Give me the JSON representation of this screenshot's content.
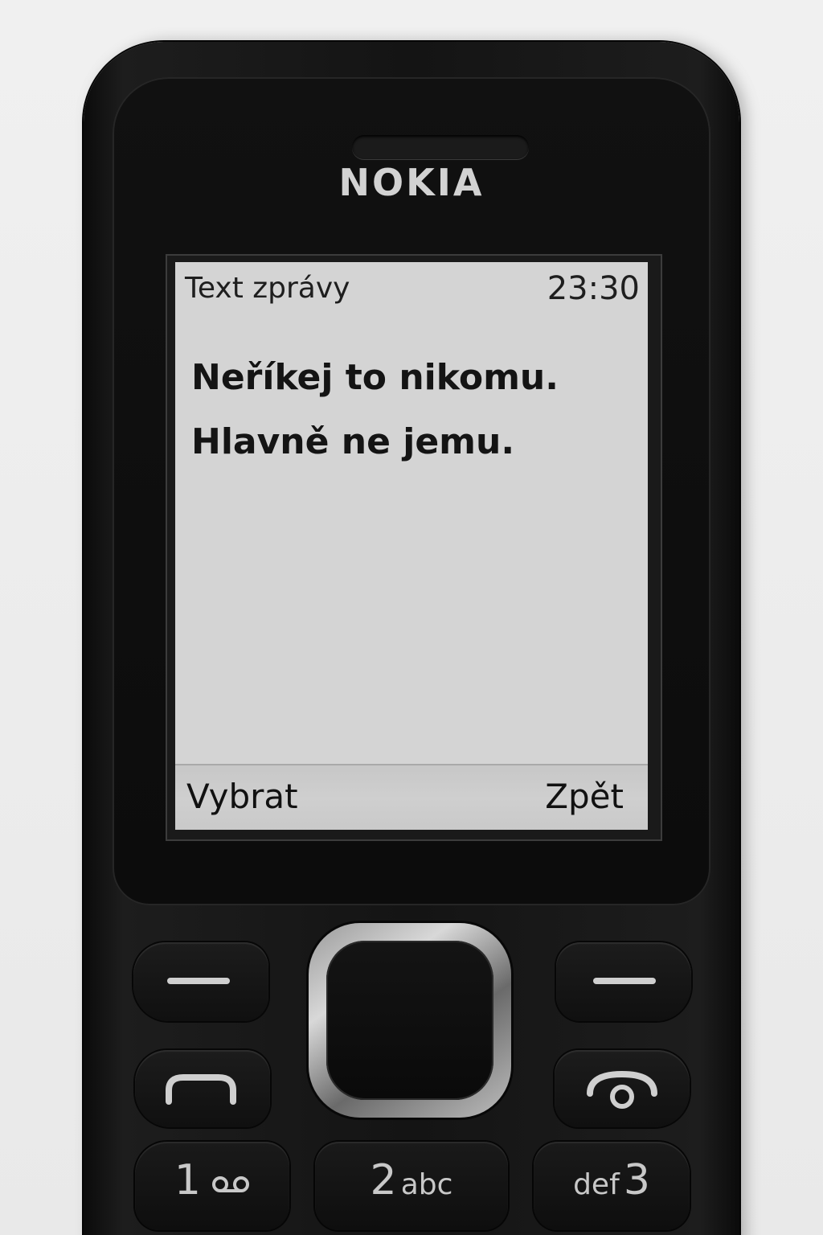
{
  "phone": {
    "brand": "NOKIA"
  },
  "screen": {
    "title": "Text zprávy",
    "time": "23:30",
    "message_lines": [
      "Neříkej to nikomu.",
      "Hlavně ne jemu."
    ],
    "softkey_left": "Vybrat",
    "softkey_right": "Zpět"
  },
  "keypad": {
    "key1": {
      "digit": "1",
      "icon": "voicemail-icon"
    },
    "key2": {
      "digit": "2",
      "letters": "abc"
    },
    "key3": {
      "letters": "def",
      "digit": "3"
    }
  },
  "colors": {
    "screen_bg": "#d4d4d4",
    "softkey_bar_bg": "#c9c9c9",
    "phone_body": "#141414",
    "text": "#141414"
  }
}
